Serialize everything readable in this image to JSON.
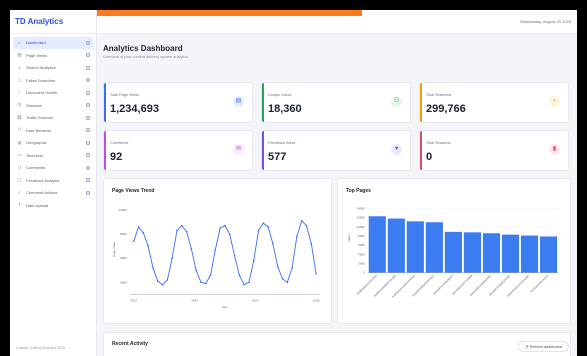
{
  "app": {
    "brand": "TD Analytics",
    "date": "Wednesday, August 20 2025"
  },
  "sidebar": {
    "items": [
      {
        "label": "Dashboard",
        "icon": "home-icon",
        "active": true
      },
      {
        "label": "Page Views",
        "icon": "bar-chart-icon"
      },
      {
        "label": "Search Analytics",
        "icon": "search-icon"
      },
      {
        "label": "Failed Searches",
        "icon": "warning-icon"
      },
      {
        "label": "Document Health",
        "icon": "heart-icon"
      },
      {
        "label": "Sessions",
        "icon": "clock-icon"
      },
      {
        "label": "Traffic Sources",
        "icon": "link-icon"
      },
      {
        "label": "User Behavior",
        "icon": "users-icon"
      },
      {
        "label": "Geographic",
        "icon": "globe-icon"
      },
      {
        "label": "Technical",
        "icon": "monitor-icon"
      },
      {
        "label": "Comments",
        "icon": "comment-icon"
      },
      {
        "label": "Feedback Analysis",
        "icon": "chat-icon"
      },
      {
        "label": "Comment Actions",
        "icon": "check-icon"
      },
      {
        "label": "Data Upload",
        "icon": "upload-icon"
      }
    ],
    "footer": "Loaded: Drilling Analytics 2025"
  },
  "dashboard": {
    "title": "Analytics Dashboard",
    "subtitle": "Overview of your content delivery system analytics"
  },
  "metrics": [
    {
      "label": "Total Page Views",
      "value": "1,234,693",
      "icon": "document-icon",
      "glyph": "▤",
      "color": "#3b6cf5",
      "bg": "#e8eefe"
    },
    {
      "label": "Unique Users",
      "value": "18,360",
      "icon": "users-icon",
      "glyph": "⚇",
      "color": "#22a55b",
      "bg": "#e5f6ec"
    },
    {
      "label": "Total Searches",
      "value": "299,766",
      "icon": "search-icon",
      "glyph": "⌕",
      "color": "#e8a300",
      "bg": "#fdf4de"
    },
    {
      "label": "Comments",
      "value": "92",
      "icon": "comment-icon",
      "glyph": "✉",
      "color": "#c04fd8",
      "bg": "#f7e8fb"
    },
    {
      "label": "Feedback Votes",
      "value": "577",
      "icon": "thumbs-up-icon",
      "glyph": "♥",
      "color": "#7a4ee0",
      "bg": "#efe9fc"
    },
    {
      "label": "Total Sessions",
      "value": "0",
      "icon": "chart-icon",
      "glyph": "▮",
      "color": "#e04a6a",
      "bg": "#fde8ee"
    }
  ],
  "charts": {
    "trend_title": "Page Views Trend",
    "top_title": "Top Pages"
  },
  "recent": {
    "title": "Recent Activity"
  },
  "refresh": {
    "label": "Refresh dashboard"
  },
  "chart_data": [
    {
      "type": "line",
      "title": "Page Views Trend",
      "xlabel": "Day",
      "ylabel": "Page Views",
      "x_ticks": [
        "2012",
        "2024",
        "2027",
        "2030"
      ],
      "y_ticks": [
        "10000",
        "8000",
        "6000",
        "4000"
      ],
      "ylim": [
        3000,
        10500
      ],
      "color": "#3b6cf5",
      "values": [
        7400,
        8600,
        8100,
        7000,
        5200,
        4100,
        3800,
        4200,
        6000,
        8300,
        8700,
        8200,
        6800,
        5000,
        4000,
        3900,
        4600,
        6700,
        8500,
        8700,
        8000,
        6200,
        4600,
        3800,
        4000,
        5800,
        8300,
        8900,
        8600,
        7200,
        5300,
        4300,
        4000,
        5200,
        7800,
        9100,
        8700,
        7200,
        4700
      ]
    },
    {
      "type": "bar",
      "title": "Top Pages",
      "ylabel": "Views",
      "y_ticks": [
        "14000",
        "12000",
        "10000",
        "8000",
        "6000",
        "4000",
        "2000",
        "0"
      ],
      "ylim": [
        0,
        15000
      ],
      "color": "#3b7cf0",
      "categories": [
        "/drilling/ops/overview",
        "/wells/completion/guide",
        "/safety/procedures/main",
        "/reports/daily/summary",
        "/equipment/rig/specs",
        "/geology/survey/data",
        "/training/modules/intro",
        "/logistics/supply/chain",
        "/maintenance/schedule",
        "/contacts/directory"
      ],
      "values": [
        12300,
        11800,
        11200,
        11000,
        8900,
        8800,
        8600,
        8300,
        8100,
        7900
      ]
    }
  ]
}
